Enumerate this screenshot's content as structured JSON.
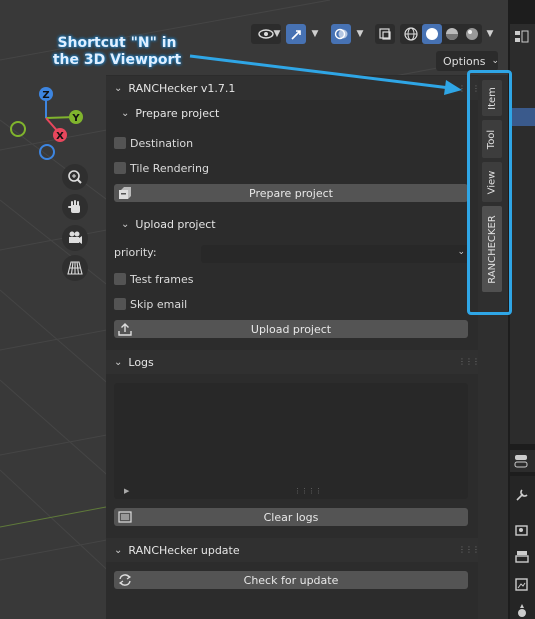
{
  "annotation": {
    "line1": "Shortcut \"N\" in",
    "line2": "the 3D Viewport"
  },
  "header": {
    "options_label": "Options"
  },
  "gizmo": {
    "x_label": "X",
    "y_label": "Y",
    "z_label": "Z",
    "x_color": "#e8475d",
    "y_color": "#80b42d",
    "z_color": "#3d85e0"
  },
  "panel": {
    "title": "RANCHecker  v1.7.1",
    "prepare": {
      "heading": "Prepare project",
      "destination_label": "Destination",
      "tile_rendering_label": "Tile Rendering",
      "button_label": "Prepare project"
    },
    "upload": {
      "heading": "Upload project",
      "priority_label": "priority:",
      "priority_value": "",
      "test_frames_label": "Test frames",
      "skip_email_label": "Skip email",
      "button_label": "Upload project"
    }
  },
  "logs": {
    "heading": "Logs",
    "clear_label": "Clear logs"
  },
  "update": {
    "heading": "RANCHecker update",
    "button_label": "Check for update"
  },
  "sidebar_tabs": [
    "Item",
    "Tool",
    "View",
    "RANCHECKER"
  ],
  "colors": {
    "accent_blue": "#4772b3",
    "annotation_blue": "#2fa6e6"
  }
}
